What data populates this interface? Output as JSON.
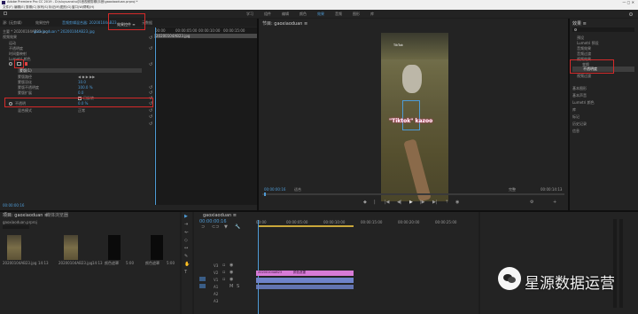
{
  "window": {
    "title": "Adobe Premiere Pro CC 2019 - D:\\sluyuanshu\\抖音视频剪辑\\抖音\\gaoxiaoduan.prproj *",
    "menu": [
      "文件(F)",
      "编辑(E)",
      "剪辑(C)",
      "序列(S)",
      "标记(M)",
      "图形(G)",
      "窗口(W)",
      "帮助(H)"
    ]
  },
  "workspaces": {
    "items": [
      "学习",
      "组件",
      "编辑",
      "颜色",
      "效果",
      "音频",
      "图形",
      "库"
    ],
    "active_index": 4
  },
  "effect_controls": {
    "tabs": [
      "源: (无剪辑)",
      "效果控件",
      "音频剪辑混合器: 20200104AB23",
      "元数据"
    ],
    "active_tab_label": "效果控件 ≡",
    "source_label": "主要 * 20200104AB23.jpg",
    "sequence_label": "gaoxiaoduan * 20200104AB23.jpg",
    "section_video": "视频效果",
    "ruler": [
      "00:00",
      "00:00:05:00",
      "00:00:10:00",
      "00:00:15:00"
    ],
    "clip_bar": "20200104AB23.jpg",
    "rows": [
      {
        "label": "运动"
      },
      {
        "label": "不透明度"
      },
      {
        "label": "时间重映射"
      },
      {
        "label": "Lumetri 颜色"
      },
      {
        "label": "蒙版(1)"
      },
      {
        "label": "蒙版路径"
      },
      {
        "label": "蒙版羽化",
        "value": "10.0"
      },
      {
        "label": "蒙版不透明度",
        "value": "100.0 %"
      },
      {
        "label": "蒙版扩展",
        "value": "0.0"
      },
      {
        "label": "已反转"
      },
      {
        "label": "不透明",
        "value": "0.0 %"
      },
      {
        "label": "混合模式",
        "value": "正常"
      }
    ],
    "timecode": "00:00:00:16"
  },
  "program_monitor": {
    "title": "节目: gaoxiaoduan ≡",
    "timecode_left": "00:00:00:16",
    "fit": "适合",
    "quality": "完整",
    "timecode_right": "00:00:14:13",
    "overlay_text": "\"Tiktok\" kazoo",
    "tiktok_label": "TikTok"
  },
  "right_panel": {
    "title": "效果 ≡",
    "items": [
      "预设",
      "Lumetri 预设",
      "音频效果",
      "音频过渡",
      "视频效果",
      "视频过渡"
    ],
    "sub_items": [
      "3D 运动",
      "变换",
      "图像控制",
      "实用程序",
      "扭曲",
      "时间",
      "杂色与颗粒"
    ],
    "highlight": "不透明度",
    "list2": [
      "基本图形",
      "基本声音",
      "Lumetri 颜色",
      "库",
      "标记",
      "历史记录",
      "信息"
    ]
  },
  "project_panel": {
    "tabs": [
      "项目: gaoxiaoduan ≡",
      "媒体浏览器"
    ],
    "path": "gaoxiaoduan.prproj",
    "items": [
      {
        "name": "20200104AB23.jpg",
        "duration": "14:13"
      },
      {
        "name": "20200104AB23.jpg",
        "duration": "14:13"
      },
      {
        "name": "颜色遮罩",
        "duration": "5:00"
      },
      {
        "name": "颜色遮罩",
        "duration": "5:00"
      }
    ]
  },
  "timeline": {
    "title": "gaoxiaoduan ≡",
    "timecode": "00:00:00:16",
    "ruler": [
      "00:00",
      "00:00:05:00",
      "00:00:10:00",
      "00:00:15:00",
      "00:00:20:00",
      "00:00:25:00"
    ],
    "tracks": [
      "V3",
      "V2",
      "V1",
      "A1",
      "A2",
      "A3"
    ],
    "clip_labels": [
      "20200104AB23",
      "颜色遮罩"
    ]
  },
  "watermark": "星源数据运营",
  "colors": {
    "accent": "#4e9bd6",
    "highlight": "#d42a2a",
    "clip_pink": "#d77bd7",
    "clip_blue": "#6f83c9"
  }
}
